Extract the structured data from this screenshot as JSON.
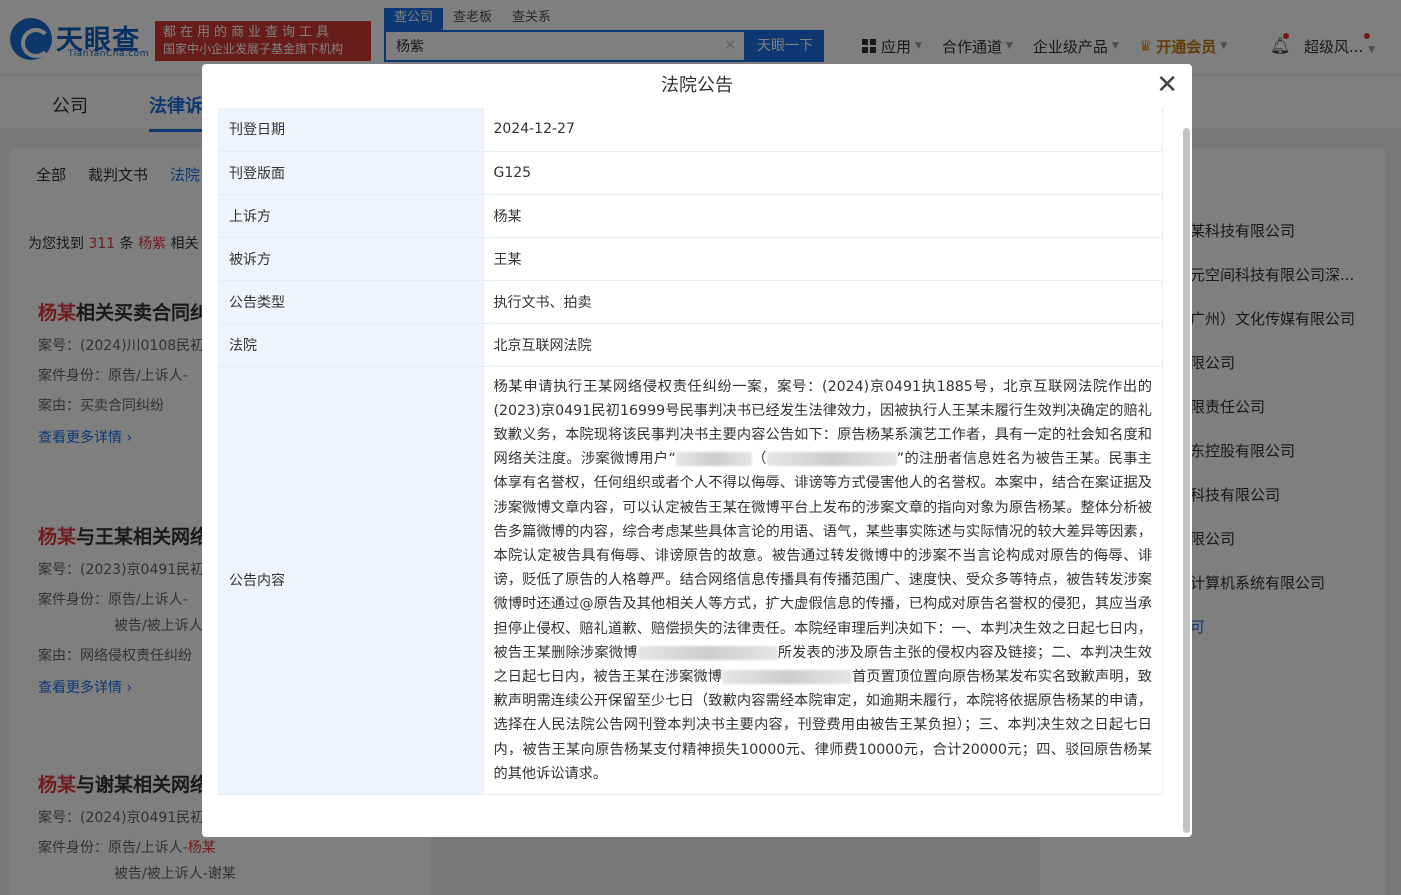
{
  "header": {
    "logo_name": "天眼查",
    "logo_sub": "TianYanCha.com",
    "slogan_line1": "都在用的商业查询工具",
    "slogan_line2": "国家中小企业发展子基金旗下机构",
    "search_tabs": [
      "查公司",
      "查老板",
      "查关系"
    ],
    "search_value": "杨紫",
    "search_button": "天眼一下",
    "nav": {
      "apps": "应用",
      "channel": "合作通道",
      "enterprise": "企业级产品",
      "vip": "开通会员",
      "user": "超级风..."
    }
  },
  "subnav": {
    "tab_company": "公司",
    "tab_legal": "法律诉"
  },
  "left": {
    "category_tabs": [
      "全部",
      "裁判文书",
      "法院"
    ],
    "count_prefix": "为您找到",
    "count": "311",
    "count_mid": "条",
    "keyword": "杨紫",
    "count_suffix": "相关",
    "items": [
      {
        "title_hl": "杨某",
        "title_rest": "相关买卖合同纠",
        "line1": "案号：(2024)川0108民初",
        "line2": "案件身份：原告/上诉人-",
        "line3": "案由：买卖合同纠纷",
        "more": "查看更多详情"
      },
      {
        "title_hl": "杨某",
        "title_rest": "与王某相关网络",
        "line1": "案号：(2023)京0491民初",
        "line2": "案件身份：原告/上诉人-",
        "line2b": "被告/被上诉人",
        "line3": "案由：网络侵权责任纠纷",
        "more": "查看更多详情"
      },
      {
        "title_hl": "杨某",
        "title_rest": "与谢某相关网络",
        "line1": "案号：(2024)京0491民初",
        "line2_prefix": "案件身份：原告/上诉人-",
        "line2_hl": "杨某",
        "line2b": "被告/被上诉人-谢某"
      }
    ]
  },
  "right": {
    "companies": [
      "某科技有限公司",
      "元空间科技有限公司深...",
      "广州）文化传媒有限公司",
      "限公司",
      "限责任公司",
      "东控股有限公司",
      "科技有限公司",
      "限公司",
      "计算机系统有限公司",
      "可"
    ]
  },
  "modal": {
    "title": "法院公告",
    "rows": [
      {
        "key": "刊登日期",
        "value": "2024-12-27"
      },
      {
        "key": "刊登版面",
        "value": "G125"
      },
      {
        "key": "上诉方",
        "value": "杨某"
      },
      {
        "key": "被诉方",
        "value": "王某"
      },
      {
        "key": "公告类型",
        "value": "执行文书、拍卖"
      },
      {
        "key": "法院",
        "value": "北京互联网法院"
      }
    ],
    "content_key": "公告内容",
    "content_p1": "杨某申请执行王某网络侵权责任纠纷一案，案号：(2024)京0491执1885号，北京互联网法院作出的(2023)京0491民初16999号民事判决书已经发生法律效力，因被执行人王某未履行生效判决确定的赔礼致歉义务，本院现将该民事判决书主要内容公告如下：原告杨某系演艺工作者，具有一定的社会知名度和网络关注度。涉案微博用户“",
    "content_p2": "”的注册者信息姓名为被告王某。民事主体享有名誉权，任何组织或者个人不得以侮辱、诽谤等方式侵害他人的名誉权。本案中，结合在案证据及涉案微博文章内容，可以认定被告王某在微博平台上发布的涉案文章的指向对象为原告杨某。整体分析被告多篇微博的内容，综合考虑某些具体言论的用语、语气，某些事实陈述与实际情况的较大差异等因素，本院认定被告具有侮辱、诽谤原告的故意。被告通过转发微博中的涉案不当言论构成对原告的侮辱、诽谤，贬低了原告的人格尊严。结合网络信息传播具有传播范围广、速度快、受众多等特点，被告转发涉案微博时还通过@原告及其他相关人等方式，扩大虚假信息的传播，已构成对原告名誉权的侵犯，其应当承担停止侵权、赔礼道歉、赔偿损失的法律责任。本院经审理后判决如下：一、本判决生效之日起七日内，被告王某删除涉案微博",
    "content_p3": "所发表的涉及原告主张的侵权内容及链接；二、本判决生效之日起七日内，被告王某在涉案微博",
    "content_p4": "首页置顶位置向原告杨某发布实名致歉声明，致歉声明需连续公开保留至少七日（致歉内容需经本院审定，如逾期未履行，本院将依据原告杨某的申请，选择在人民法院公告网刊登本判决书主要内容，刊登费用由被告王某负担）；三、本判决生效之日起七日内，被告王某向原告杨某支付精神损失10000元、律师费10000元，合计20000元；四、驳回原告杨某的其他诉讼请求。"
  },
  "colors": {
    "accent": "#1a71e8",
    "highlight": "#e4393c",
    "key_bg": "#eef4fb"
  }
}
